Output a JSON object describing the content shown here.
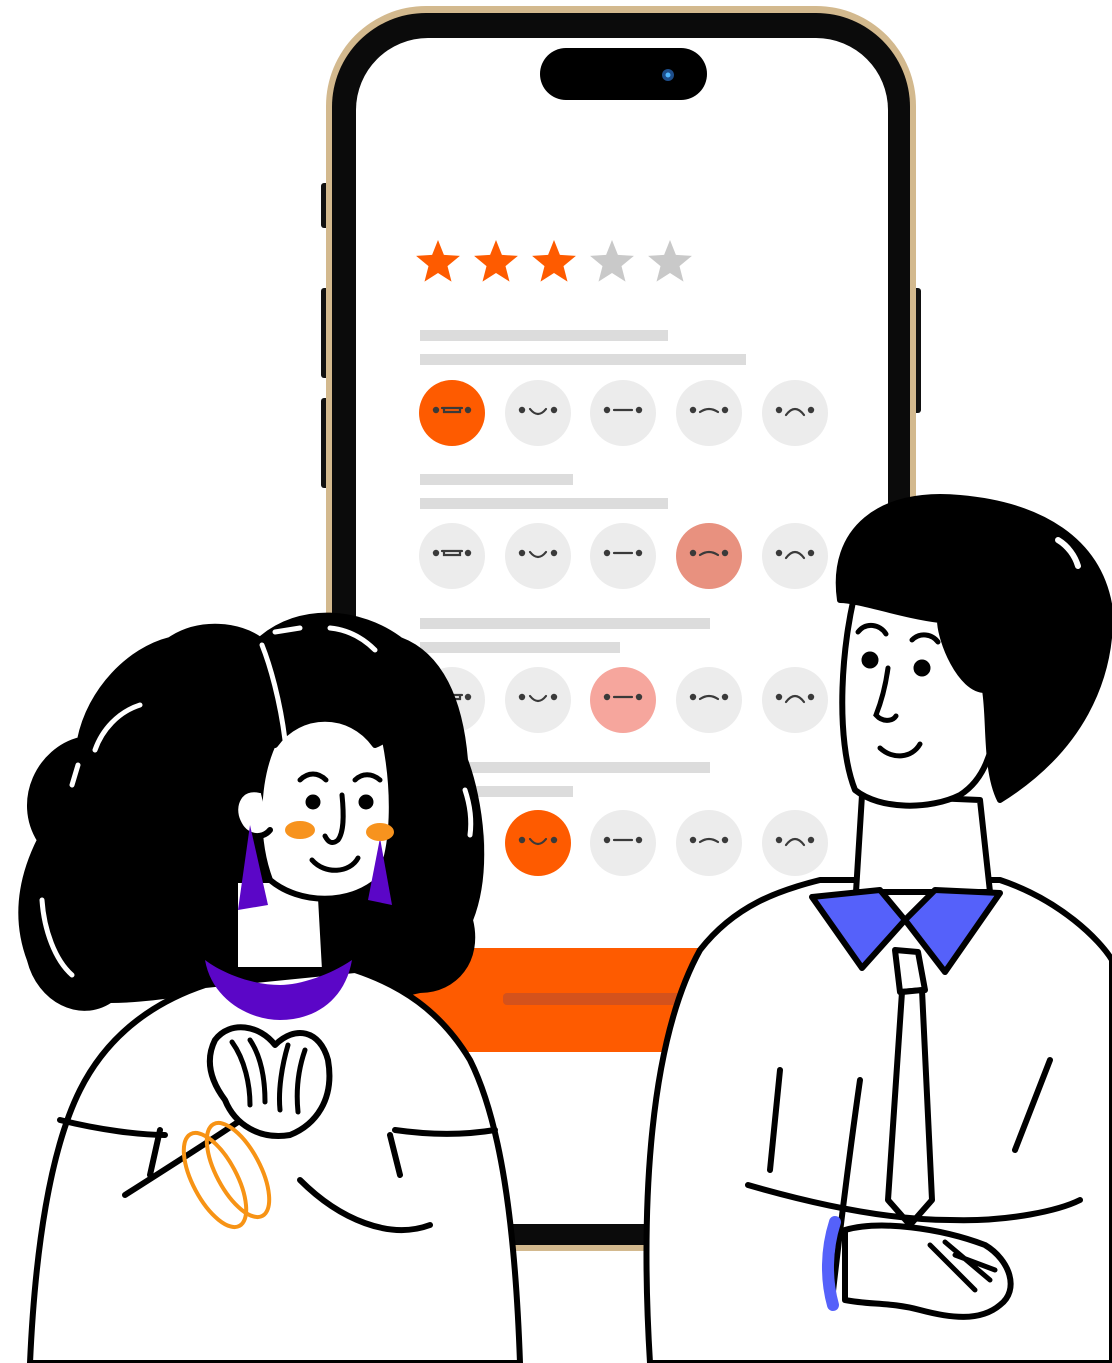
{
  "survey": {
    "star_rating": {
      "value": 3,
      "max": 5
    },
    "questions": [
      {
        "selected_index": 0,
        "selected_color": "#fe5b00"
      },
      {
        "selected_index": 3,
        "selected_color": "#e8917f"
      },
      {
        "selected_index": 2,
        "selected_color": "#f6a69d"
      },
      {
        "selected_index": 1,
        "selected_color": "#fe5b00"
      }
    ],
    "face_icons": [
      "grin-face-icon",
      "smile-face-icon",
      "neutral-face-icon",
      "slight-frown-face-icon",
      "frown-face-icon"
    ],
    "submit_button": {
      "color": "#fe5b00"
    }
  },
  "colors": {
    "accent": "#fe5b00",
    "star_off": "#c9c9c9",
    "face_off": "#ececec",
    "placeholder": "#dcdcdc",
    "shirt_collar": "#5561fa",
    "necklace": "#5b06c7",
    "bracelet": "#f79315",
    "cheek": "#f7931e"
  }
}
